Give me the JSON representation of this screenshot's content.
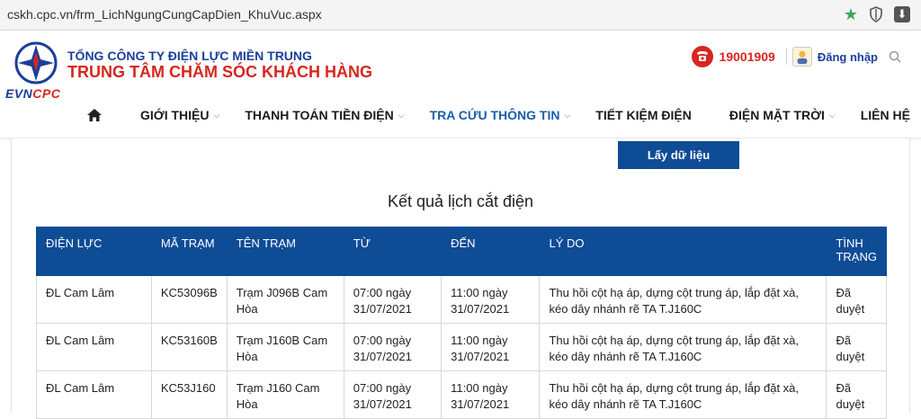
{
  "browser": {
    "url": "cskh.cpc.vn/frm_LichNgungCungCapDien_KhuVuc.aspx"
  },
  "header": {
    "logo_evn": "EVN",
    "logo_cpc": "CPC",
    "org_name": "TỔNG CÔNG TY ĐIỆN LỰC MIỀN TRUNG",
    "center_name": "TRUNG TÂM CHĂM SÓC KHÁCH HÀNG",
    "hotline": "19001909",
    "login_label": "Đăng nhập"
  },
  "nav": {
    "items": [
      {
        "label": "GIỚI THIỆU",
        "has_dropdown": true
      },
      {
        "label": "THANH TOÁN TIỀN ĐIỆN",
        "has_dropdown": true
      },
      {
        "label": "TRA CỨU THÔNG TIN",
        "has_dropdown": true
      },
      {
        "label": "TIẾT KIỆM ĐIỆN",
        "has_dropdown": false
      },
      {
        "label": "ĐIỆN MẶT TRỜI",
        "has_dropdown": true
      },
      {
        "label": "LIÊN HỆ",
        "has_dropdown": false
      }
    ]
  },
  "form": {
    "get_data_button": "Lấy dữ liệu"
  },
  "results": {
    "title": "Kết quả lịch cắt điện",
    "columns": [
      "ĐIỆN LỰC",
      "MÃ TRẠM",
      "TÊN TRẠM",
      "TỪ",
      "ĐẾN",
      "LÝ DO",
      "TÌNH TRẠNG"
    ],
    "rows": [
      [
        "ĐL Cam Lâm",
        "KC53096B",
        "Trạm J096B Cam Hòa",
        "07:00 ngày 31/07/2021",
        "11:00 ngày 31/07/2021",
        "Thu hồi cột hạ áp, dựng cột trung áp, lắp đặt xà, kéo dây nhánh rẽ TA T.J160C",
        "Đã duyệt"
      ],
      [
        "ĐL Cam Lâm",
        "KC53160B",
        "Trạm J160B Cam Hòa",
        "07:00 ngày 31/07/2021",
        "11:00 ngày 31/07/2021",
        "Thu hồi cột hạ áp, dựng cột trung áp, lắp đặt xà, kéo dây nhánh rẽ TA T.J160C",
        "Đã duyệt"
      ],
      [
        "ĐL Cam Lâm",
        "KC53J160",
        "Trạm J160 Cam Hòa",
        "07:00 ngày 31/07/2021",
        "11:00 ngày 31/07/2021",
        "Thu hồi cột hạ áp, dựng cột trung áp, lắp đặt xà, kéo dây nhánh rẽ TA T.J160C",
        "Đã duyệt"
      ]
    ]
  },
  "colors": {
    "brand_blue": "#1a3f9a",
    "brand_red": "#d7261e",
    "table_header": "#0f4c96",
    "active_nav": "#1a5ea8"
  }
}
